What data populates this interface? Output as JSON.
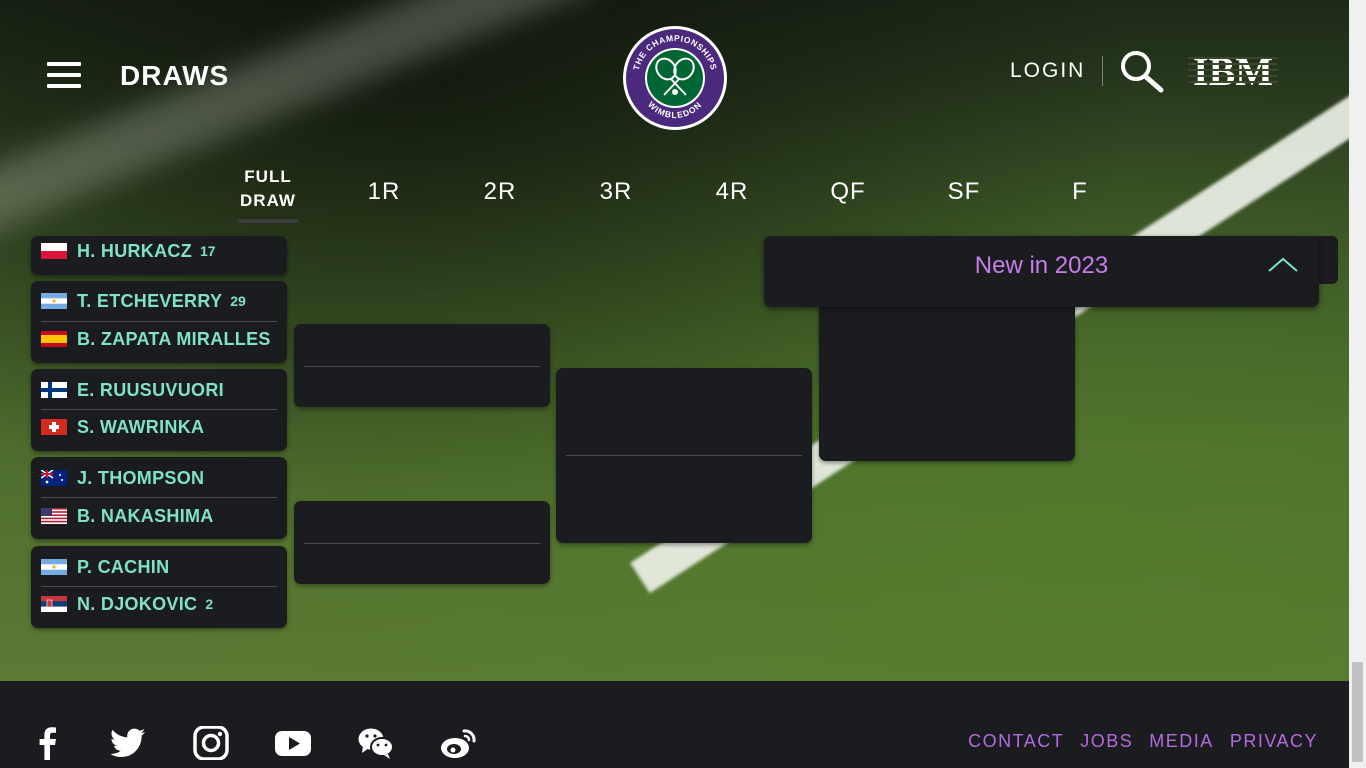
{
  "header": {
    "title": "DRAWS",
    "login_label": "LOGIN",
    "logo_top_text": "THE CHAMPIONSHIPS",
    "logo_bottom_text": "WIMBLEDON",
    "sponsor": "IBM"
  },
  "tabs": [
    {
      "label": "FULL DRAW",
      "line1": "FULL",
      "line2": "DRAW",
      "active": true
    },
    {
      "label": "1R"
    },
    {
      "label": "2R"
    },
    {
      "label": "3R"
    },
    {
      "label": "4R"
    },
    {
      "label": "QF"
    },
    {
      "label": "SF"
    },
    {
      "label": "F"
    }
  ],
  "first_round_matches": [
    {
      "players": [
        {
          "name": "H. HURKACZ",
          "seed": "17",
          "flag": "poland"
        }
      ]
    },
    {
      "players": [
        {
          "name": "T. ETCHEVERRY",
          "seed": "29",
          "flag": "argentina"
        },
        {
          "name": "B. ZAPATA MIRALLES",
          "seed": "",
          "flag": "spain"
        }
      ]
    },
    {
      "players": [
        {
          "name": "E. RUUSUVUORI",
          "seed": "",
          "flag": "finland"
        },
        {
          "name": "S. WAWRINKA",
          "seed": "",
          "flag": "switzerland"
        }
      ]
    },
    {
      "players": [
        {
          "name": "J. THOMPSON",
          "seed": "",
          "flag": "australia"
        },
        {
          "name": "B. NAKASHIMA",
          "seed": "",
          "flag": "usa"
        }
      ]
    },
    {
      "players": [
        {
          "name": "P. CACHIN",
          "seed": "",
          "flag": "argentina"
        },
        {
          "name": "N. DJOKOVIC",
          "seed": "2",
          "flag": "serbia"
        }
      ]
    }
  ],
  "new_panel": {
    "label": "New in 2023"
  },
  "footer": {
    "social_icons": [
      "facebook-icon",
      "twitter-icon",
      "instagram-icon",
      "youtube-icon",
      "wechat-icon",
      "weibo-icon"
    ],
    "links": [
      "CONTACT",
      "JOBS",
      "MEDIA",
      "PRIVACY"
    ]
  },
  "colors": {
    "player_name": "#7fe3c4",
    "accent_purple": "#b46be0",
    "card_bg": "#1b1c1f",
    "logo_purple": "#4b2a7d",
    "logo_green": "#006633"
  }
}
